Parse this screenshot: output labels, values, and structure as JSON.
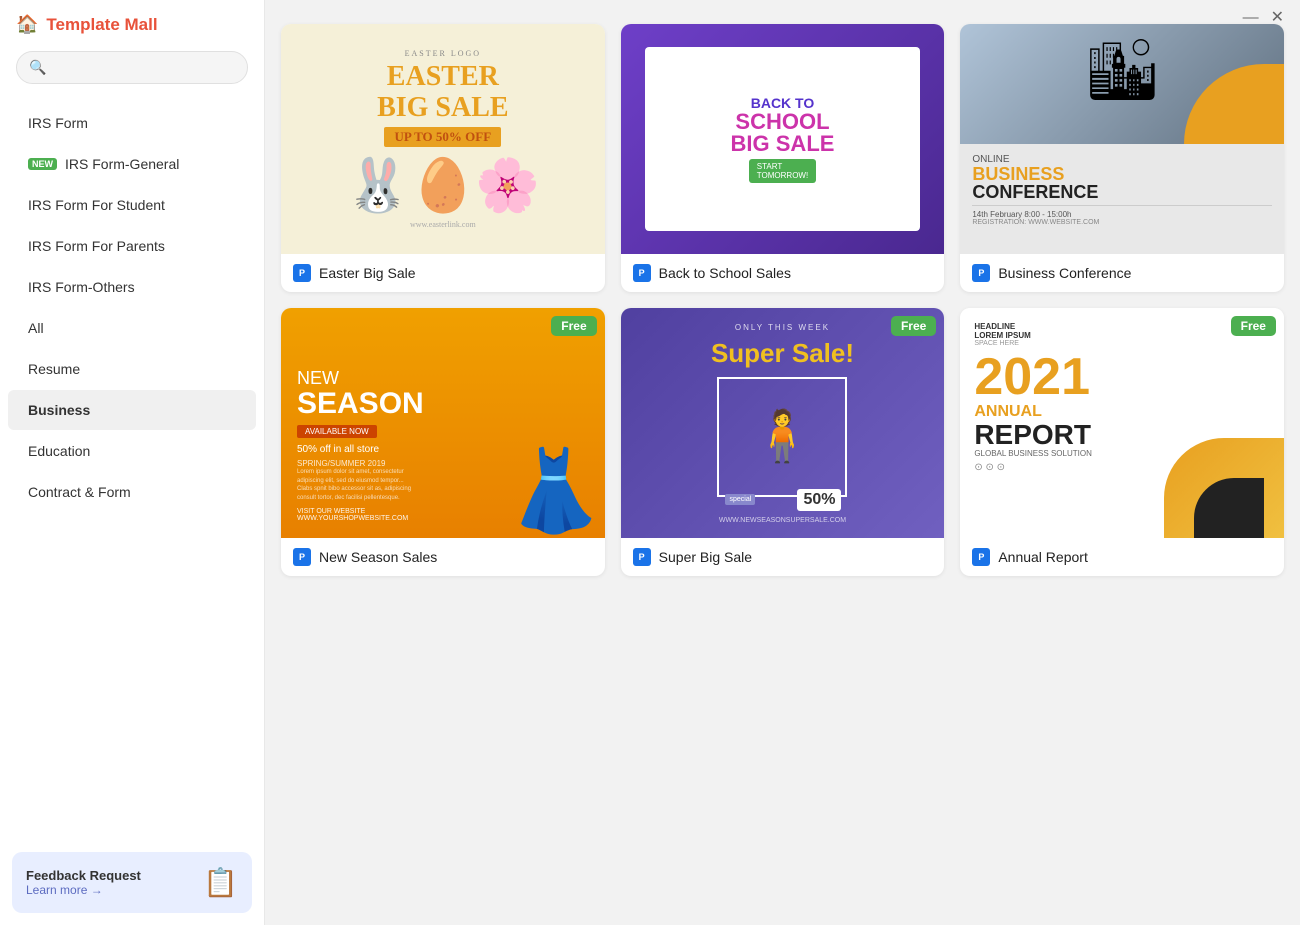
{
  "app": {
    "title": "Template Mall",
    "home_icon": "🏠"
  },
  "window_controls": {
    "minimize": "—",
    "close": "✕"
  },
  "search": {
    "placeholder": ""
  },
  "sidebar": {
    "items": [
      {
        "id": "irs-form",
        "label": "IRS Form",
        "active": false,
        "badge": ""
      },
      {
        "id": "irs-form-general",
        "label": "IRS Form-General",
        "active": false,
        "badge": "NEW"
      },
      {
        "id": "irs-form-student",
        "label": "IRS Form For Student",
        "active": false,
        "badge": ""
      },
      {
        "id": "irs-form-parents",
        "label": "IRS Form For Parents",
        "active": false,
        "badge": ""
      },
      {
        "id": "irs-form-others",
        "label": "IRS Form-Others",
        "active": false,
        "badge": ""
      },
      {
        "id": "all",
        "label": "All",
        "active": false,
        "badge": ""
      },
      {
        "id": "resume",
        "label": "Resume",
        "active": false,
        "badge": ""
      },
      {
        "id": "business",
        "label": "Business",
        "active": true,
        "badge": ""
      },
      {
        "id": "education",
        "label": "Education",
        "active": false,
        "badge": ""
      },
      {
        "id": "contract-form",
        "label": "Contract & Form",
        "active": false,
        "badge": ""
      }
    ],
    "feedback": {
      "title": "Feedback Request",
      "link": "Learn more →",
      "icon": "📋"
    }
  },
  "templates": [
    {
      "id": "easter-big-sale",
      "label": "Easter Big Sale",
      "free": false,
      "type": "easter"
    },
    {
      "id": "back-to-school",
      "label": "Back to School Sales",
      "free": false,
      "type": "school"
    },
    {
      "id": "business-conference",
      "label": "Business Conference",
      "free": false,
      "type": "conf"
    },
    {
      "id": "new-season-sales",
      "label": "New Season Sales",
      "free": true,
      "type": "season"
    },
    {
      "id": "super-big-sale",
      "label": "Super Big Sale",
      "free": true,
      "type": "super"
    },
    {
      "id": "annual-report",
      "label": "Annual Report",
      "free": true,
      "type": "annual"
    }
  ],
  "labels": {
    "free": "Free",
    "ppt_icon_text": "P"
  }
}
